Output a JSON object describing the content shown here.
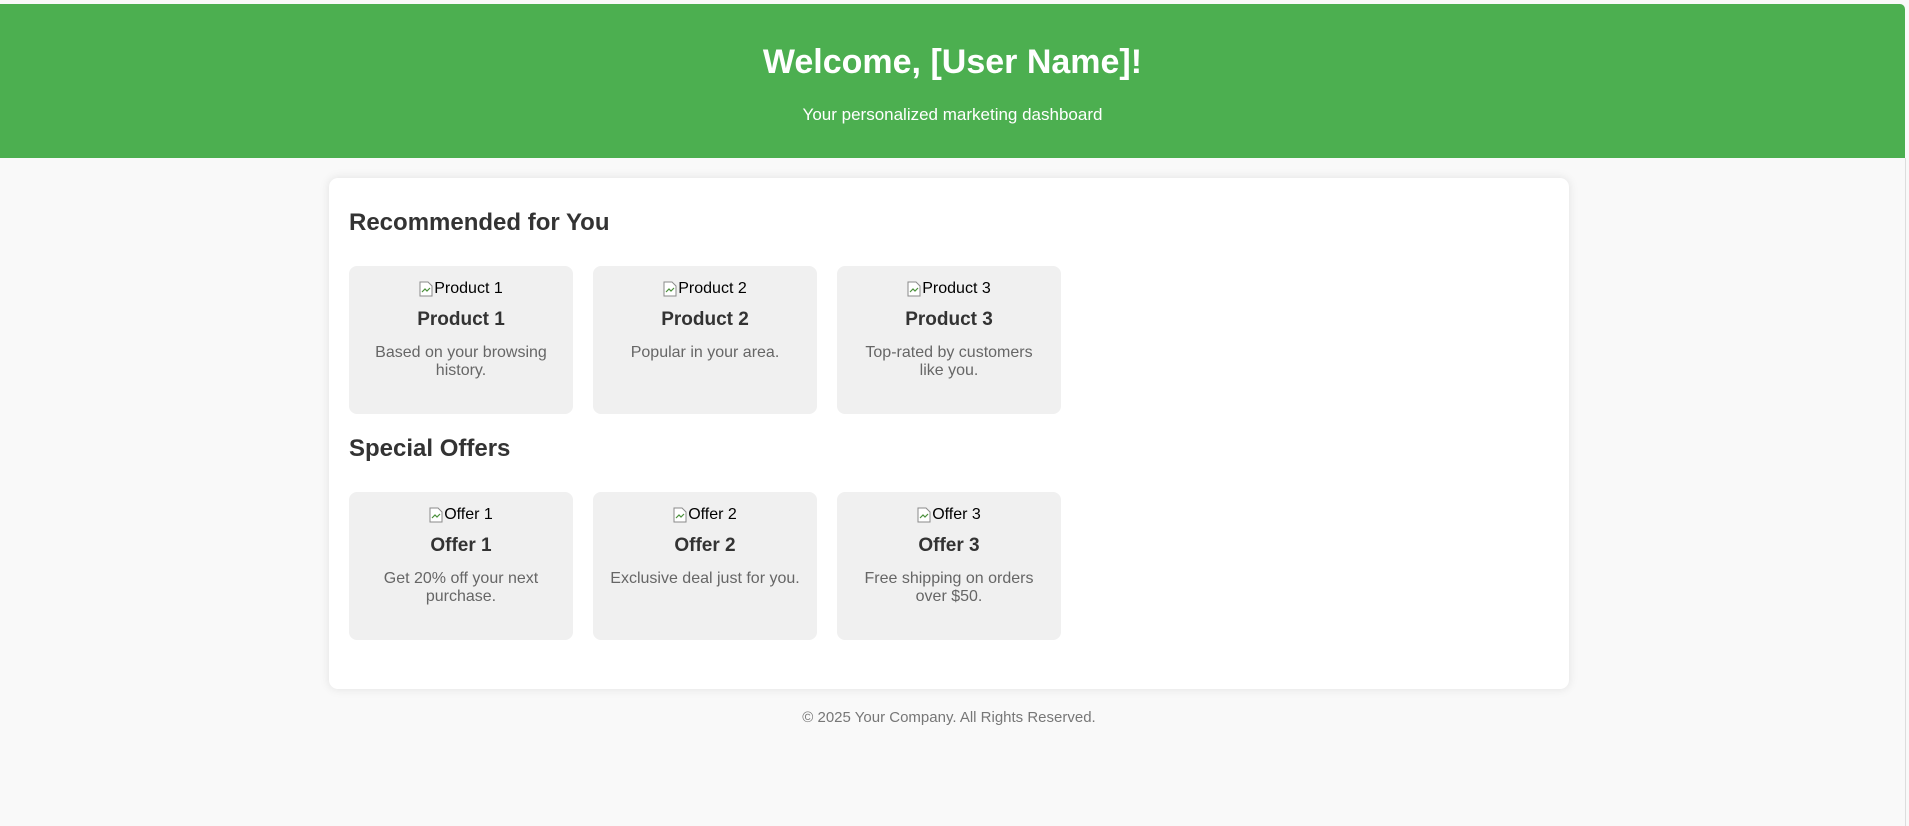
{
  "header": {
    "title": "Welcome, [User Name]!",
    "subtitle": "Your personalized marketing dashboard",
    "background_color": "#4caf50"
  },
  "recommended": {
    "title": "Recommended for You",
    "items": [
      {
        "image_alt": "Product 1",
        "name": "Product 1",
        "description": "Based on your browsing history."
      },
      {
        "image_alt": "Product 2",
        "name": "Product 2",
        "description": "Popular in your area."
      },
      {
        "image_alt": "Product 3",
        "name": "Product 3",
        "description": "Top-rated by customers like you."
      }
    ]
  },
  "offers": {
    "title": "Special Offers",
    "items": [
      {
        "image_alt": "Offer 1",
        "name": "Offer 1",
        "description": "Get 20% off your next purchase."
      },
      {
        "image_alt": "Offer 2",
        "name": "Offer 2",
        "description": "Exclusive deal just for you."
      },
      {
        "image_alt": "Offer 3",
        "name": "Offer 3",
        "description": "Free shipping on orders over $50."
      }
    ]
  },
  "footer": {
    "text": "© 2025 Your Company. All Rights Reserved."
  },
  "icons": {
    "image_placeholder": "broken-image-icon"
  }
}
